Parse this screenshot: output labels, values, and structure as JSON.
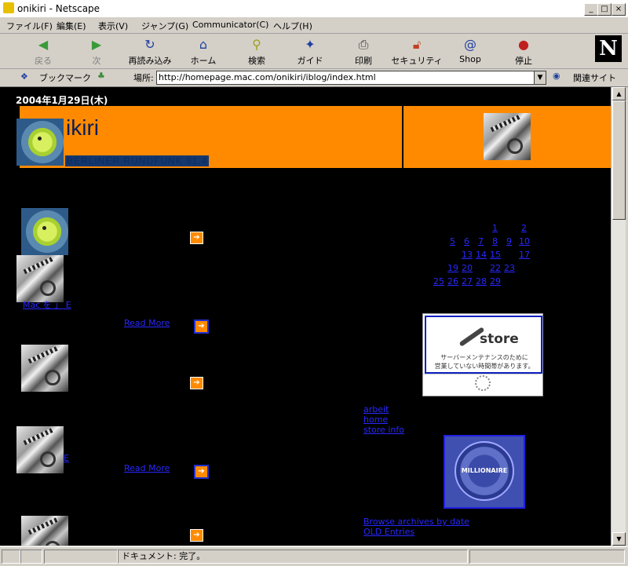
{
  "window": {
    "title": "onikiri - Netscape"
  },
  "menu": [
    "ファイル(F)",
    "編集(E)",
    "表示(V)",
    "ジャンプ(G)",
    "Communicator(C)",
    "ヘルプ(H)"
  ],
  "toolbar": {
    "back": "戻る",
    "forward": "次",
    "reload": "再読み込み",
    "home": "ホーム",
    "search": "検索",
    "guide": "ガイド",
    "print": "印刷",
    "security": "セキュリティ",
    "shop": "Shop",
    "stop": "停止"
  },
  "location": {
    "bookmarks": "ブックマーク",
    "label": "場所:",
    "url": "http://homepage.mac.com/onikiri/iblog/index.html",
    "related": "関連サイト"
  },
  "page": {
    "date": "2004年1月29日(木)",
    "site_title": "ikiri",
    "subtitle": "BERLINER RUNDFUNK 91.4",
    "post1_link": "Mac を 」 E",
    "read_more": "Read More",
    "post2_link": "E",
    "read_more2": "Read More",
    "side_links": [
      "arbeit",
      "home",
      "store info"
    ],
    "bottom_links": [
      "Browse archives by date",
      "OLD Entries"
    ],
    "store": {
      "word": "store",
      "msg1": "サーバーメンテナンスのために",
      "msg2": "営業していない時間帯があります。"
    },
    "millionaire": "MILLIONAIRE"
  },
  "calendar": [
    "1",
    "2",
    "5",
    "6",
    "7",
    "8",
    "9",
    "10",
    "13",
    "14",
    "15",
    "17",
    "19",
    "20",
    "22",
    "23",
    "25",
    "26",
    "27",
    "28",
    "29"
  ],
  "status": {
    "text": "ドキュメント: 完了。"
  }
}
